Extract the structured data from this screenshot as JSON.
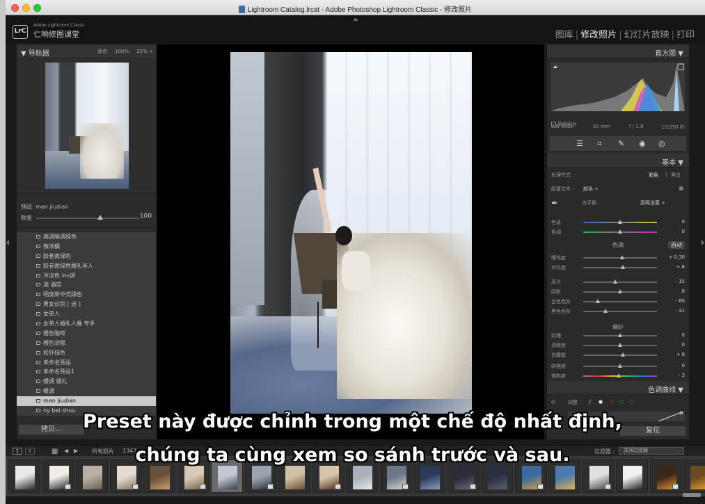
{
  "window": {
    "title": "Lightroom Catalog.lrcat - Adobe Photoshop Lightroom Classic - 修改照片"
  },
  "brand": {
    "logo": "LrC",
    "product_line": "Adobe Lightroom Classic",
    "identity_plate": "仁响修图课堂"
  },
  "modules": {
    "library": "图库",
    "develop": "修改照片",
    "slideshow": "幻灯片放映",
    "print": "打印",
    "separator": "|"
  },
  "navigator": {
    "title": "导航器",
    "zoom_fit": "适合",
    "zoom_100": "100%",
    "zoom_25": "25%"
  },
  "preset_amount": {
    "preset_label": "预设: man jiudian",
    "amount_label": "数量",
    "amount_value": "100",
    "amount_fraction": 0.62
  },
  "presets": [
    {
      "name": "高调暗调绿色"
    },
    {
      "name": "微浓橘"
    },
    {
      "name": "胶卷黄绿色"
    },
    {
      "name": "胶卷黄绿色婚礼半人"
    },
    {
      "name": "冷淡色 ins调"
    },
    {
      "name": "酒 酒店"
    },
    {
      "name": "明度新中式绿色"
    },
    {
      "name": "男女识别 [ 送 ]"
    },
    {
      "name": "女单人"
    },
    {
      "name": "女单人婚礼人像 专手"
    },
    {
      "name": "橙色咖啡"
    },
    {
      "name": "橙色浓郁"
    },
    {
      "name": "松针绿色"
    },
    {
      "name": "未命名预设"
    },
    {
      "name": "未命名预设1"
    },
    {
      "name": "暖调 婚礼"
    },
    {
      "name": "暖调"
    },
    {
      "name": "man jiudian",
      "selected": true
    },
    {
      "name": "ny bei shou"
    }
  ],
  "left_buttons": {
    "copy": "拷贝..."
  },
  "histogram": {
    "title": "直方图",
    "iso": "ISO 1000",
    "focal": "50 mm",
    "aperture": "f / 1.8",
    "shutter": "1/1250 秒",
    "original_photo": "原始照片"
  },
  "basic": {
    "title": "基本",
    "treatment_label": "处理方式 :",
    "color": "彩色",
    "bw": "黑白",
    "profile_label": "配置文件 :",
    "profile_value": "颜色 ÷",
    "wb_label": "白平衡 :",
    "wb_value": "原照设置 ÷",
    "temp_label": "色温",
    "temp_val": "0",
    "tint_label": "色调",
    "tint_val": "0",
    "tone_title": "色调",
    "auto": "自动",
    "exposure_label": "曝光度",
    "exposure_val": "+ 0.30",
    "contrast_label": "对比度",
    "contrast_val": "+ 8",
    "highlights_label": "高光",
    "highlights_val": "- 15",
    "shadows_label": "阴影",
    "shadows_val": "0",
    "whites_label": "白色色阶",
    "whites_val": "- 60",
    "blacks_label": "黑色色阶",
    "blacks_val": "- 41",
    "presence_title": "偏好",
    "texture_label": "纹理",
    "texture_val": "0",
    "clarity_label": "清晰度",
    "clarity_val": "0",
    "dehaze_label": "去朦胧",
    "dehaze_val": "+ 8",
    "vibrance_label": "鲜艳度",
    "vibrance_val": "0",
    "saturation_label": "饱和度",
    "saturation_val": "- 3"
  },
  "tone_curve": {
    "title": "色调曲线",
    "adjust_label": "调整 :"
  },
  "right_buttons": {
    "reset": "复位"
  },
  "filmstrip_bar": {
    "page1": "1",
    "page2": "2",
    "source": "所有照片",
    "count": "1347",
    "filter_label": "过滤器 :",
    "filter_value": "关闭过滤器"
  },
  "subtitles": {
    "line1": "Preset này được chỉnh trong một chế độ nhất định,",
    "line2": "chúng ta cùng xem so sánh trước và sau."
  },
  "colors": {
    "accent_selected": "#c9c9c9",
    "panel_bg": "#2a2a2a",
    "subtitle_text": "#ffffff"
  }
}
